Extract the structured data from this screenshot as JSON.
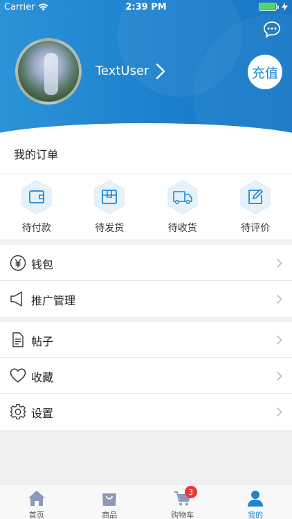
{
  "status_bar": {
    "carrier": "Carrier",
    "time": "2:39 PM"
  },
  "header": {
    "username": "TextUser",
    "recharge_label": "充值"
  },
  "orders": {
    "title": "我的订单",
    "items": [
      {
        "label": "待付款",
        "icon": "wallet-icon"
      },
      {
        "label": "待发货",
        "icon": "package-icon"
      },
      {
        "label": "待收货",
        "icon": "truck-icon"
      },
      {
        "label": "待评价",
        "icon": "edit-icon"
      }
    ]
  },
  "menu_group_1": [
    {
      "label": "钱包",
      "icon": "yuan-icon"
    },
    {
      "label": "推广管理",
      "icon": "speaker-icon"
    }
  ],
  "menu_group_2": [
    {
      "label": "帖子",
      "icon": "document-icon"
    },
    {
      "label": "收藏",
      "icon": "heart-icon"
    },
    {
      "label": "设置",
      "icon": "gear-icon"
    }
  ],
  "tabbar": {
    "items": [
      {
        "label": "首页",
        "icon": "home-icon"
      },
      {
        "label": "商品",
        "icon": "shopping-bag-icon"
      },
      {
        "label": "购物车",
        "icon": "cart-icon",
        "badge": "3"
      },
      {
        "label": "我的",
        "icon": "user-icon",
        "active": true
      }
    ]
  },
  "colors": {
    "accent": "#1e84d0",
    "badge": "#e83a3a",
    "icon_hex_bg": "#e6f2fb"
  }
}
